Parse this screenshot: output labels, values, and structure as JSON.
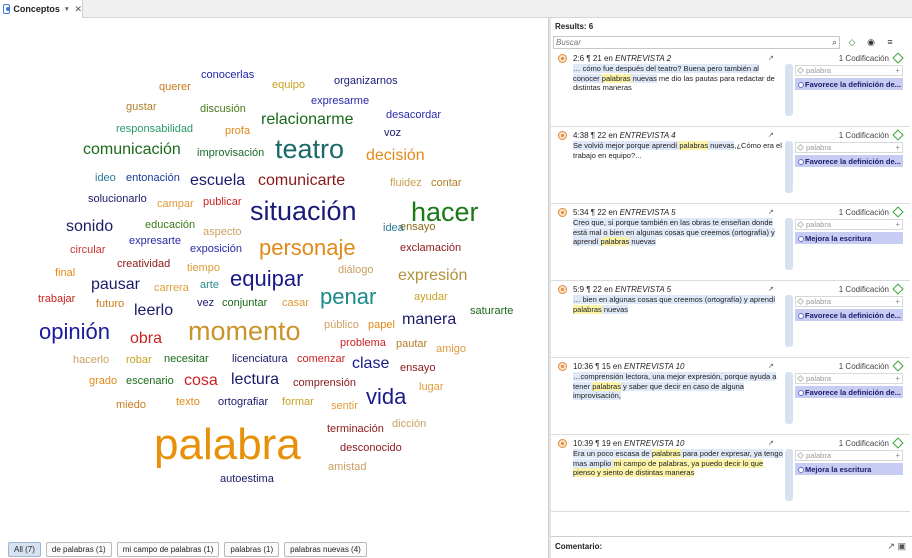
{
  "tab": {
    "title": "Conceptos",
    "arrow": "▾",
    "close": "✕"
  },
  "cloud_words": [
    {
      "text": "conocerlas",
      "color": "#2222aa",
      "size": 11
    },
    {
      "text": "querer",
      "color": "#c97a1a",
      "size": 11
    },
    {
      "text": "equipo",
      "color": "#c9a020",
      "size": 11
    },
    {
      "text": "organizarnos",
      "color": "#1a1a7a",
      "size": 11
    },
    {
      "text": "gustar",
      "color": "#b0802a",
      "size": 11
    },
    {
      "text": "discusión",
      "color": "#4a7a1a",
      "size": 11
    },
    {
      "text": "expresarme",
      "color": "#2a2aaa",
      "size": 11
    },
    {
      "text": "responsabilidad",
      "color": "#2a9a6a",
      "size": 11
    },
    {
      "text": "profa",
      "color": "#e08a1a",
      "size": 11
    },
    {
      "text": "relacionarme",
      "color": "#1a6a1a",
      "size": 16
    },
    {
      "text": "desacordar",
      "color": "#2a2aaa",
      "size": 11
    },
    {
      "text": "voz",
      "color": "#1a1a6a",
      "size": 11
    },
    {
      "text": "comunicación",
      "color": "#1a6a1a",
      "size": 16
    },
    {
      "text": "improvisación",
      "color": "#1a6a2a",
      "size": 11
    },
    {
      "text": "teatro",
      "color": "#1a6a6a",
      "size": 27
    },
    {
      "text": "decisión",
      "color": "#e08a1a",
      "size": 16
    },
    {
      "text": "ideo",
      "color": "#2a7a9a",
      "size": 11
    },
    {
      "text": "entonación",
      "color": "#1a3a9a",
      "size": 11
    },
    {
      "text": "escuela",
      "color": "#1a1a6a",
      "size": 16
    },
    {
      "text": "comunicarte",
      "color": "#8a1a1a",
      "size": 16
    },
    {
      "text": "fluidez",
      "color": "#c9a050",
      "size": 11
    },
    {
      "text": "contar",
      "color": "#b0802a",
      "size": 11
    },
    {
      "text": "solucionarlo",
      "color": "#1a1a6a",
      "size": 11
    },
    {
      "text": "campar",
      "color": "#e09a3a",
      "size": 11
    },
    {
      "text": "publicar",
      "color": "#cc2222",
      "size": 11
    },
    {
      "text": "situación",
      "color": "#1a1a7a",
      "size": 27
    },
    {
      "text": "hacer",
      "color": "#1a7a1a",
      "size": 27
    },
    {
      "text": "ensayo",
      "color": "#8a6a1a",
      "size": 11
    },
    {
      "text": "sonido",
      "color": "#1a1a6a",
      "size": 16
    },
    {
      "text": "educación",
      "color": "#3a7a1a",
      "size": 11
    },
    {
      "text": "aspecto",
      "color": "#d0a060",
      "size": 11
    },
    {
      "text": "idea",
      "color": "#2a7a9a",
      "size": 11
    },
    {
      "text": "circular",
      "color": "#cc3333",
      "size": 11
    },
    {
      "text": "expresarte",
      "color": "#2a2aaa",
      "size": 11
    },
    {
      "text": "exposición",
      "color": "#2a2aaa",
      "size": 11
    },
    {
      "text": "personaje",
      "color": "#e08a1a",
      "size": 22
    },
    {
      "text": "exclamación",
      "color": "#8a1a1a",
      "size": 11
    },
    {
      "text": "creatividad",
      "color": "#8a1a1a",
      "size": 11
    },
    {
      "text": "tiempo",
      "color": "#e09a3a",
      "size": 11
    },
    {
      "text": "diálogo",
      "color": "#c9a060",
      "size": 11
    },
    {
      "text": "final",
      "color": "#e08a1a",
      "size": 11
    },
    {
      "text": "equipar",
      "color": "#1a1a8a",
      "size": 22
    },
    {
      "text": "expresión",
      "color": "#b0903a",
      "size": 16
    },
    {
      "text": "pausar",
      "color": "#1a1a6a",
      "size": 16
    },
    {
      "text": "arte",
      "color": "#2a8a8a",
      "size": 11
    },
    {
      "text": "carrera",
      "color": "#e0a03a",
      "size": 11
    },
    {
      "text": "trabajar",
      "color": "#cc2222",
      "size": 11
    },
    {
      "text": "penar",
      "color": "#1a8a8a",
      "size": 22
    },
    {
      "text": "ayudar",
      "color": "#c9a020",
      "size": 11
    },
    {
      "text": "futuro",
      "color": "#c97a1a",
      "size": 11
    },
    {
      "text": "leerlo",
      "color": "#1a1a6a",
      "size": 16
    },
    {
      "text": "vez",
      "color": "#1a1a6a",
      "size": 11
    },
    {
      "text": "conjuntar",
      "color": "#1a6a1a",
      "size": 11
    },
    {
      "text": "casar",
      "color": "#e09a3a",
      "size": 11
    },
    {
      "text": "saturarte",
      "color": "#1a6a1a",
      "size": 11
    },
    {
      "text": "manera",
      "color": "#1a1a6a",
      "size": 16
    },
    {
      "text": "opinión",
      "color": "#1a1a9a",
      "size": 22
    },
    {
      "text": "obra",
      "color": "#cc2222",
      "size": 16
    },
    {
      "text": "momento",
      "color": "#c9942a",
      "size": 27
    },
    {
      "text": "público",
      "color": "#d0a060",
      "size": 11
    },
    {
      "text": "papel",
      "color": "#e08a1a",
      "size": 11
    },
    {
      "text": "problema",
      "color": "#cc2222",
      "size": 11
    },
    {
      "text": "pautar",
      "color": "#b0802a",
      "size": 11
    },
    {
      "text": "amigo",
      "color": "#e09a3a",
      "size": 11
    },
    {
      "text": "hacerlo",
      "color": "#c9a060",
      "size": 11
    },
    {
      "text": "robar",
      "color": "#c9a020",
      "size": 11
    },
    {
      "text": "necesitar",
      "color": "#1a6a1a",
      "size": 11
    },
    {
      "text": "licenciatura",
      "color": "#1a1a6a",
      "size": 11
    },
    {
      "text": "comenzar",
      "color": "#cc2222",
      "size": 11
    },
    {
      "text": "clase",
      "color": "#1a1a8a",
      "size": 16
    },
    {
      "text": "ensayo",
      "color": "#8a1a1a",
      "size": 11
    },
    {
      "text": "grado",
      "color": "#e08a1a",
      "size": 11
    },
    {
      "text": "escenario",
      "color": "#1a6a1a",
      "size": 11
    },
    {
      "text": "cosa",
      "color": "#cc2222",
      "size": 16
    },
    {
      "text": "lectura",
      "color": "#1a1a6a",
      "size": 16
    },
    {
      "text": "comprensión",
      "color": "#8a1a1a",
      "size": 11
    },
    {
      "text": "lugar",
      "color": "#e09a3a",
      "size": 11
    },
    {
      "text": "vida",
      "color": "#1a1a8a",
      "size": 22
    },
    {
      "text": "miedo",
      "color": "#c97a1a",
      "size": 11
    },
    {
      "text": "texto",
      "color": "#e08a1a",
      "size": 11
    },
    {
      "text": "ortografiar",
      "color": "#1a1a6a",
      "size": 11
    },
    {
      "text": "formar",
      "color": "#c9a020",
      "size": 11
    },
    {
      "text": "sentir",
      "color": "#e09a3a",
      "size": 11
    },
    {
      "text": "palabra",
      "color": "#e8900a",
      "size": 44
    },
    {
      "text": "terminación",
      "color": "#8a1a1a",
      "size": 11
    },
    {
      "text": "dicción",
      "color": "#c9a060",
      "size": 11
    },
    {
      "text": "desconocido",
      "color": "#8a1a1a",
      "size": 11
    },
    {
      "text": "amistad",
      "color": "#c9a060",
      "size": 11
    },
    {
      "text": "autoestima",
      "color": "#1a1a6a",
      "size": 11
    }
  ],
  "filters": [
    {
      "label": "All (7)",
      "active": true
    },
    {
      "label": "de palabras (1)",
      "active": false
    },
    {
      "label": "mi campo de palabras (1)",
      "active": false
    },
    {
      "label": "palabras (1)",
      "active": false
    },
    {
      "label": "palabras nuevas (4)",
      "active": false
    }
  ],
  "results": {
    "header": "Results: 6",
    "search_placeholder": "Buscar",
    "search_icon": "search-icon",
    "items": [
      {
        "ref": "2:6 ¶ 21 en ",
        "doc": "ENTREVISTA 2",
        "text": "… cómo fue después del teatro? Buena pero también al conocer palabras nuevas me dio las pautas para redactar de distintas maneras",
        "count": "1 Codificación",
        "code_placeholder": "palabra",
        "code": "Favorece la definición de..."
      },
      {
        "ref": "4:38 ¶ 22 en ",
        "doc": "ENTREVISTA 4",
        "text": "Se volvió mejor porque aprendí palabras nuevas,¿Cómo era el trabajo en equipo?...",
        "count": "1 Codificación",
        "code_placeholder": "palabra",
        "code": "Favorece la definición de..."
      },
      {
        "ref": "5:34 ¶ 22 en ",
        "doc": "ENTREVISTA 5",
        "text": "Creo que, si porque también en las obras te enseñan donde está mal o bien en algunas cosas que creemos (ortografía) y aprendí palabras nuevas",
        "count": "1 Codificación",
        "code_placeholder": "palabra",
        "code": "Mejora la escritura"
      },
      {
        "ref": "5:9 ¶ 22 en ",
        "doc": "ENTREVISTA 5",
        "text": "… bien en algunas cosas que creemos (ortografía) y aprendí palabras nuevas",
        "count": "1 Codificación",
        "code_placeholder": "palabra",
        "code": "Favorece la definición de..."
      },
      {
        "ref": "10:36 ¶ 15 en ",
        "doc": "ENTREVISTA 10",
        "text": "…comprensión lectora, una mejor expresión, porque ayuda a tener palabras y saber que decir en caso de alguna improvisación,",
        "count": "1 Codificación",
        "code_placeholder": "palabra",
        "code": "Favorece la definición de..."
      },
      {
        "ref": "10:39 ¶ 19 en ",
        "doc": "ENTREVISTA 10",
        "text": "Era un poco escasa de palabras para poder expresar, ya tengo mas amplio mi campo de palabras, ya puedo decir lo que pienso y siento de distintas maneras",
        "count": "1 Codificación",
        "code_placeholder": "palabra",
        "code": "Mejora la escritura"
      }
    ]
  },
  "comment_label": "Comentario:"
}
